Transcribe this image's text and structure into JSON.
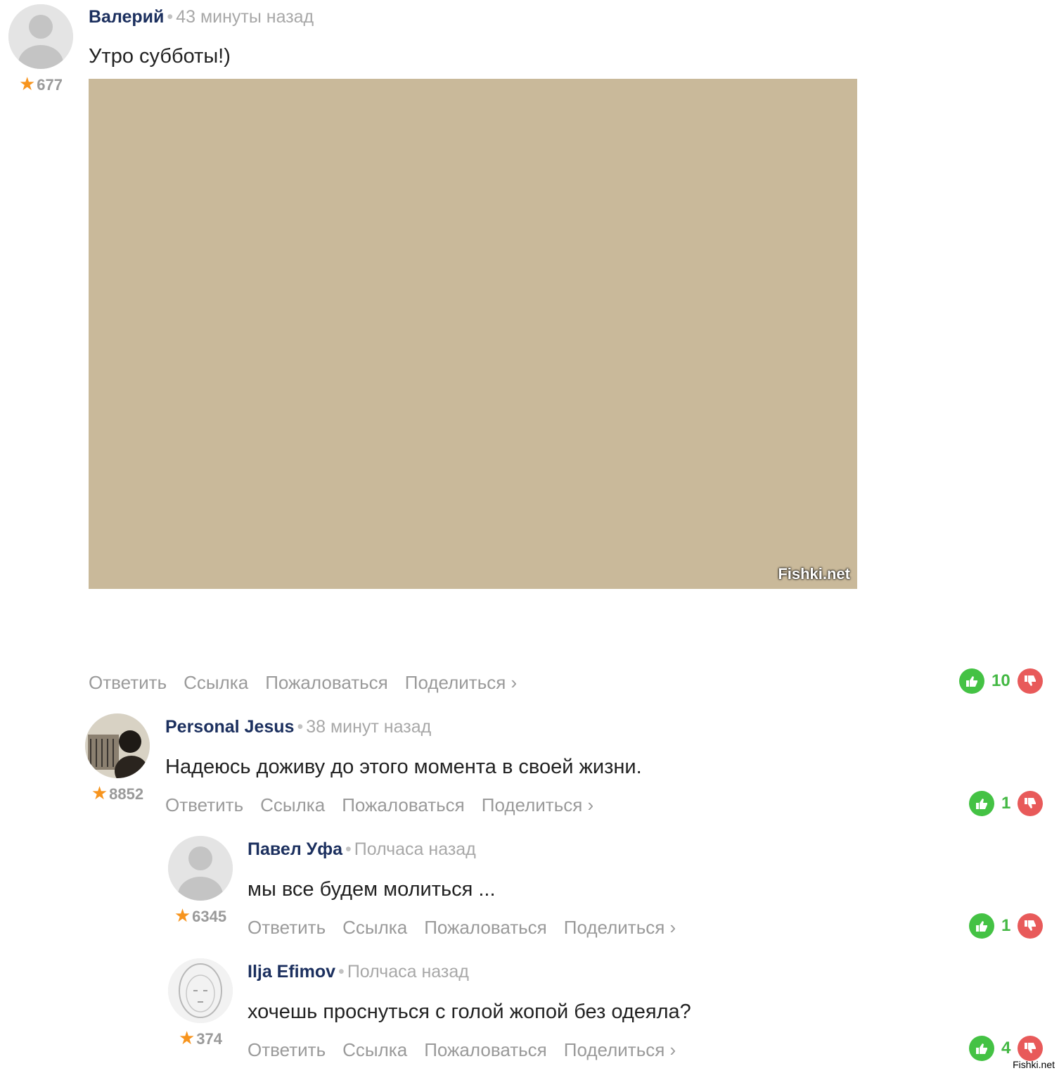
{
  "comments": [
    {
      "author": "Валерий",
      "time": "43 минуты назад",
      "rating": "677",
      "text": "Утро субботы!)",
      "actions": [
        "Ответить",
        "Ссылка",
        "Пожаловаться",
        "Поделиться ›"
      ],
      "votes": "10",
      "avatar": "default-avatar-icon"
    },
    {
      "author": "Personal Jesus",
      "time": "38 минут назад",
      "rating": "8852",
      "text": "Надеюсь доживу до этого момента в своей жизни.",
      "actions": [
        "Ответить",
        "Ссылка",
        "Пожаловаться",
        "Поделиться ›"
      ],
      "votes": "1",
      "avatar": "user-photo-avatar"
    },
    {
      "author": "Павел Уфа",
      "time": "Полчаса назад",
      "rating": "6345",
      "text": "мы все будем молиться ...",
      "actions": [
        "Ответить",
        "Ссылка",
        "Пожаловаться",
        "Поделиться ›"
      ],
      "votes": "1",
      "avatar": "default-avatar-icon"
    },
    {
      "author": "Ilja Efimov",
      "time": "Полчаса назад",
      "rating": "374",
      "text": "хочешь проснуться с голой жопой без одеяла?",
      "actions": [
        "Ответить",
        "Ссылка",
        "Пожаловаться",
        "Поделиться ›"
      ],
      "votes": "4",
      "avatar": "user-sketch-avatar"
    }
  ],
  "photo": {
    "watermark": "Fishki.net"
  },
  "site_mark": "Fishki.net",
  "colors": {
    "author": "#1b2f5e",
    "muted": "#9a9a9a",
    "star": "#f7941d",
    "vote_up": "#44c244",
    "vote_down": "#e85a5a"
  }
}
